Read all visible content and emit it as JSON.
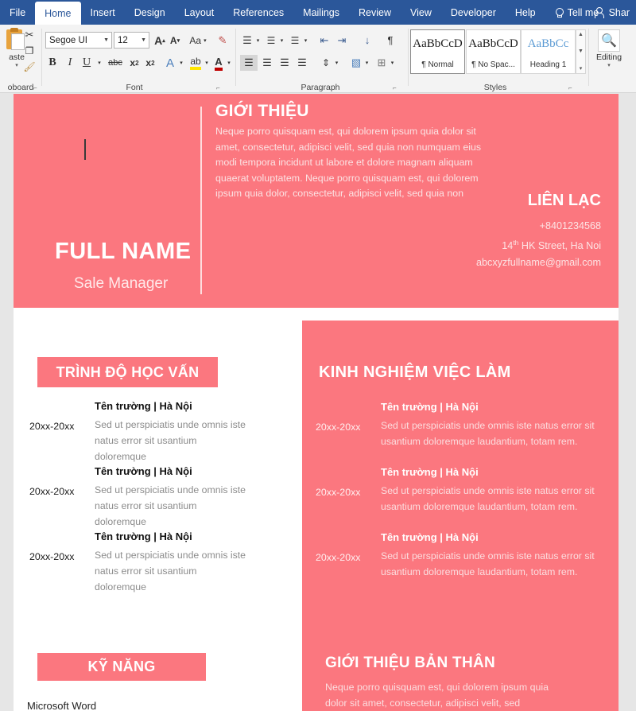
{
  "theme": {
    "coral": "#fb777f",
    "ribbon_blue": "#2b579a"
  },
  "titlebar": {
    "tabs": [
      {
        "label": "File",
        "active": false
      },
      {
        "label": "Home",
        "active": true
      },
      {
        "label": "Insert",
        "active": false
      },
      {
        "label": "Design",
        "active": false
      },
      {
        "label": "Layout",
        "active": false
      },
      {
        "label": "References",
        "active": false
      },
      {
        "label": "Mailings",
        "active": false
      },
      {
        "label": "Review",
        "active": false
      },
      {
        "label": "View",
        "active": false
      },
      {
        "label": "Developer",
        "active": false
      },
      {
        "label": "Help",
        "active": false
      }
    ],
    "tell_me": "Tell me",
    "share": "Shar"
  },
  "ribbon": {
    "groups": [
      {
        "name": "Clipboard",
        "label": "oboard"
      },
      {
        "name": "Font",
        "label": "Font"
      },
      {
        "name": "Paragraph",
        "label": "Paragraph"
      },
      {
        "name": "Styles",
        "label": "Styles"
      }
    ],
    "clipboard": {
      "paste_label": "aste",
      "cut_icon": "scissors-icon",
      "copy_icon": "copy-icon",
      "format_painter_icon": "format-painter-icon"
    },
    "font": {
      "font_family_value": "Segoe UI",
      "font_size_value": "12",
      "grow_font": "A",
      "shrink_font": "A",
      "change_case": "Aa",
      "clear_formatting": "clear-formatting-icon",
      "bold": "B",
      "italic": "I",
      "underline": "U",
      "strikethrough": "abc",
      "subscript": "x",
      "subscript_sup": "2",
      "superscript": "x",
      "superscript_sup": "2",
      "text_effects": "A",
      "highlight": "ab",
      "font_color": "A"
    },
    "paragraph": {
      "bullets": "bullets-icon",
      "numbering": "numbering-icon",
      "multilevel": "multilevel-list-icon",
      "decrease_indent": "decrease-indent-icon",
      "increase_indent": "increase-indent-icon",
      "sort": "sort-icon",
      "show_marks": "¶",
      "align_left": "align-left-icon",
      "align_center": "align-center-icon",
      "align_right": "align-right-icon",
      "justify": "justify-icon",
      "line_spacing": "line-spacing-icon",
      "shading": "shading-icon",
      "borders": "borders-icon"
    },
    "styles": {
      "items": [
        {
          "sample": "AaBbCcD",
          "name": "¶ Normal",
          "selected": true
        },
        {
          "sample": "AaBbCcD",
          "name": "¶ No Spac...",
          "selected": false
        },
        {
          "sample": "AaBbCc",
          "name": "Heading 1",
          "selected": false
        }
      ]
    },
    "editing": {
      "label": "Editing",
      "icon": "search-icon"
    }
  },
  "document": {
    "header": {
      "intro_title": "GIỚI THIỆU",
      "intro_body": "Neque porro quisquam est, qui dolorem ipsum quia dolor sit amet, consectetur, adipisci velit, sed quia non numquam eius modi tempora incidunt ut labore et dolore magnam aliquam quaerat voluptatem. Neque porro quisquam est, qui dolorem ipsum quia dolor, consectetur, adipisci velit, sed quia non",
      "contact_title": "LIÊN LẠC",
      "contact_phone": "+8401234568",
      "contact_address_num": "14",
      "contact_address_sup": "th",
      "contact_address_rest": " HK Street, Ha Noi",
      "contact_email": "abcxyzfullname@gmail.com",
      "full_name": "FULL NAME",
      "role": "Sale Manager"
    },
    "education": {
      "heading": "TRÌNH ĐỘ HỌC VẤN",
      "entries": [
        {
          "year": "20xx-20xx",
          "org": "Tên trường | Hà Nội",
          "desc": "Sed ut perspiciatis unde omnis iste natus error sit usantium doloremque"
        },
        {
          "year": "20xx-20xx",
          "org": "Tên trường | Hà Nội",
          "desc": "Sed ut perspiciatis unde omnis iste natus error sit usantium doloremque"
        },
        {
          "year": "20xx-20xx",
          "org": "Tên trường | Hà Nội",
          "desc": "Sed ut perspiciatis unde omnis iste natus error sit usantium doloremque"
        }
      ]
    },
    "experience": {
      "heading": "KINH NGHIỆM VIỆC LÀM",
      "entries": [
        {
          "year": "20xx-20xx",
          "org": "Tên trường | Hà Nội",
          "desc": "Sed ut perspiciatis unde omnis iste natus error sit usantium doloremque laudantium, totam rem."
        },
        {
          "year": "20xx-20xx",
          "org": "Tên trường | Hà Nội",
          "desc": "Sed ut perspiciatis unde omnis iste natus error sit usantium doloremque laudantium, totam rem."
        },
        {
          "year": "20xx-20xx",
          "org": "Tên trường | Hà Nội",
          "desc": "Sed ut perspiciatis unde omnis iste natus error sit usantium doloremque laudantium, totam rem."
        }
      ]
    },
    "skills": {
      "heading": "KỸ NĂNG",
      "items": [
        "Microsoft Word"
      ]
    },
    "about": {
      "heading": "GIỚI THIỆU BẢN THÂN",
      "body": "Neque porro quisquam est, qui dolorem ipsum quia dolor sit amet, consectetur, adipisci velit, sed"
    }
  }
}
